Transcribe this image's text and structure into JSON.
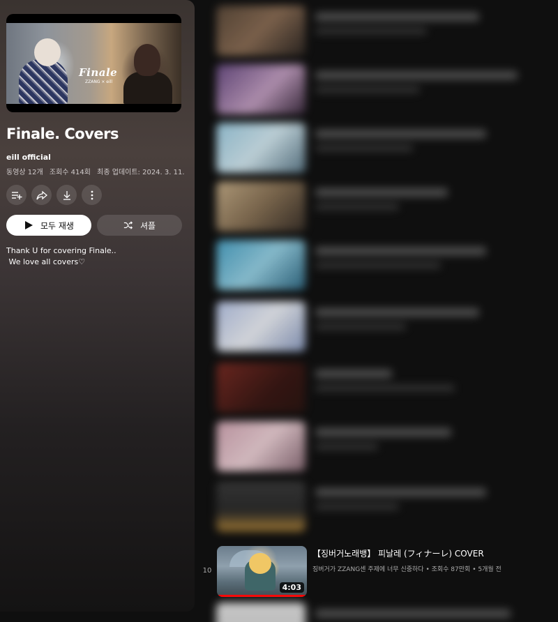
{
  "playlist": {
    "hero": {
      "title": "Finale",
      "subtitle": "ZZANG × eill"
    },
    "title": "Finale. Covers",
    "owner": "eill official",
    "meta": {
      "videos": "동영상 12개",
      "views": "조회수 414회",
      "updated": "최종 업데이트: 2024. 3. 11."
    },
    "actions": [
      {
        "name": "save-to-playlist",
        "icon": "playlist-add-icon"
      },
      {
        "name": "share",
        "icon": "share-icon"
      },
      {
        "name": "download",
        "icon": "download-icon"
      },
      {
        "name": "more",
        "icon": "more-vert-icon"
      }
    ],
    "play_all_label": "모두 재생",
    "shuffle_label": "셔플",
    "description": "Thank U for covering Finale..\n We love all covers♡"
  },
  "videos": [
    {
      "index": "10",
      "title": "【징버거노래뱅】 피날레 (フィナーレ) COVER",
      "channel": "징버거가 ZZANG센 주제에 너무 신중하다",
      "views": "조회수 87만회",
      "age": "5개월 전",
      "duration": "4:03",
      "watched_progress": 1.0
    }
  ],
  "colors": {
    "accent": "#ff0000",
    "background": "#0f0f0f"
  }
}
